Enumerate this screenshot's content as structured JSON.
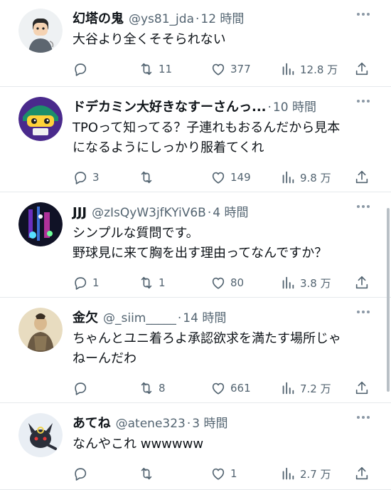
{
  "tweets": [
    {
      "name": "幻塔の鬼",
      "handle": "@ys81_jda",
      "sep": "·",
      "time": "12 時間",
      "lines": [
        "大谷より全くそそられない"
      ],
      "reply": "",
      "retweet": "11",
      "like": "377",
      "views": "12.8 万"
    },
    {
      "name": "ドデカミン大好きなすーさんっ...",
      "handle": "",
      "sep": "·",
      "time": "10 時間",
      "lines": [
        "TPOって知ってる？子連れもおるんだから見本",
        "になるようにしっかり服着てくれ"
      ],
      "reply": "3",
      "retweet": "",
      "like": "149",
      "views": "9.8 万"
    },
    {
      "name": "JJJ",
      "handle": "@zIsQyW3jfKYiV6B",
      "sep": "·",
      "time": "4 時間",
      "lines": [
        "シンプルな質問です。",
        "野球見に来て胸を出す理由ってなんですか？"
      ],
      "reply": "1",
      "retweet": "1",
      "like": "80",
      "views": "3.8 万"
    },
    {
      "name": "金欠",
      "handle": "@_siim_____",
      "sep": "·",
      "time": "14 時間",
      "lines": [
        "ちゃんとユニ着ろよ承認欲求を満たす場所じゃ",
        "ねーんだわ"
      ],
      "reply": "",
      "retweet": "8",
      "like": "661",
      "views": "7.2 万"
    },
    {
      "name": "あてね",
      "handle": "@atene323",
      "sep": "·",
      "time": "3 時間",
      "lines": [
        "なんやこれ wwwwww"
      ],
      "reply": "",
      "retweet": "",
      "like": "1",
      "views": "2.7 万"
    }
  ],
  "icons": {
    "reply": "reply-icon",
    "retweet": "retweet-icon",
    "like": "heart-icon",
    "views": "views-icon",
    "share": "share-icon",
    "more": "more-icon"
  },
  "colors": {
    "text": "#0f1419",
    "secondary": "#536471",
    "divider": "#e6e9ec"
  }
}
